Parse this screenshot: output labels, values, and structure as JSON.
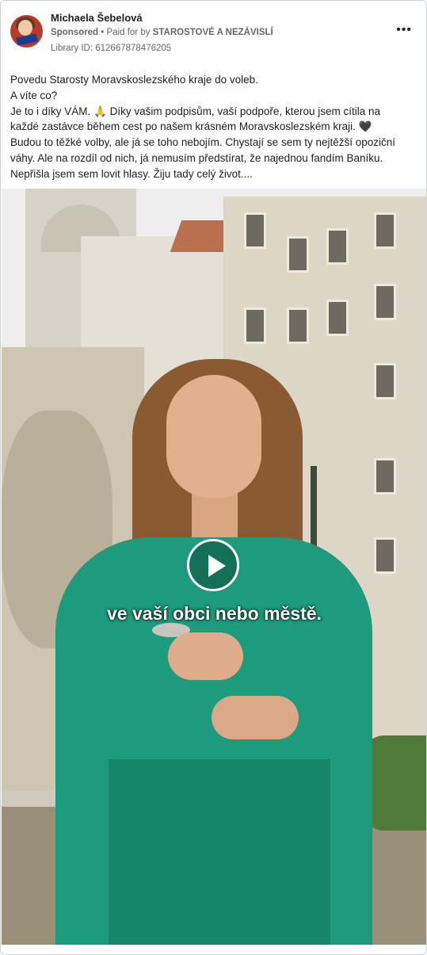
{
  "post": {
    "author": "Michaela Šebelová",
    "sponsored_label": "Sponsored",
    "paid_for_prefix": "• Paid for by",
    "paid_for_by": "STAROSTOVÉ A NEZÁVISLÍ",
    "library_id": "Library ID: 612667878476205",
    "more_icon": "more-horizontal-icon",
    "text_lines": [
      "Povedu Starosty Moravskoslezského kraje do voleb.",
      "A víte co?",
      "Je to i díky VÁM. 🙏 Díky vašim podpisům, vaší podpoře, kterou jsem cítila na",
      "každé zastávce během cest po našem krásném Moravskoslezském kraji. 🖤",
      "Budou to těžké volby, ale já se toho nebojím. Chystají se sem ty nejtěžší opoziční",
      "váhy. Ale na rozdíl od nich, já nemusím předstírat, že najednou fandím Baníku.",
      "Nepřišla jsem sem lovit hlasy. Žiju tady celý život...."
    ]
  },
  "video": {
    "caption": "ve vaší obci nebo městě.",
    "play_icon": "play-icon"
  }
}
